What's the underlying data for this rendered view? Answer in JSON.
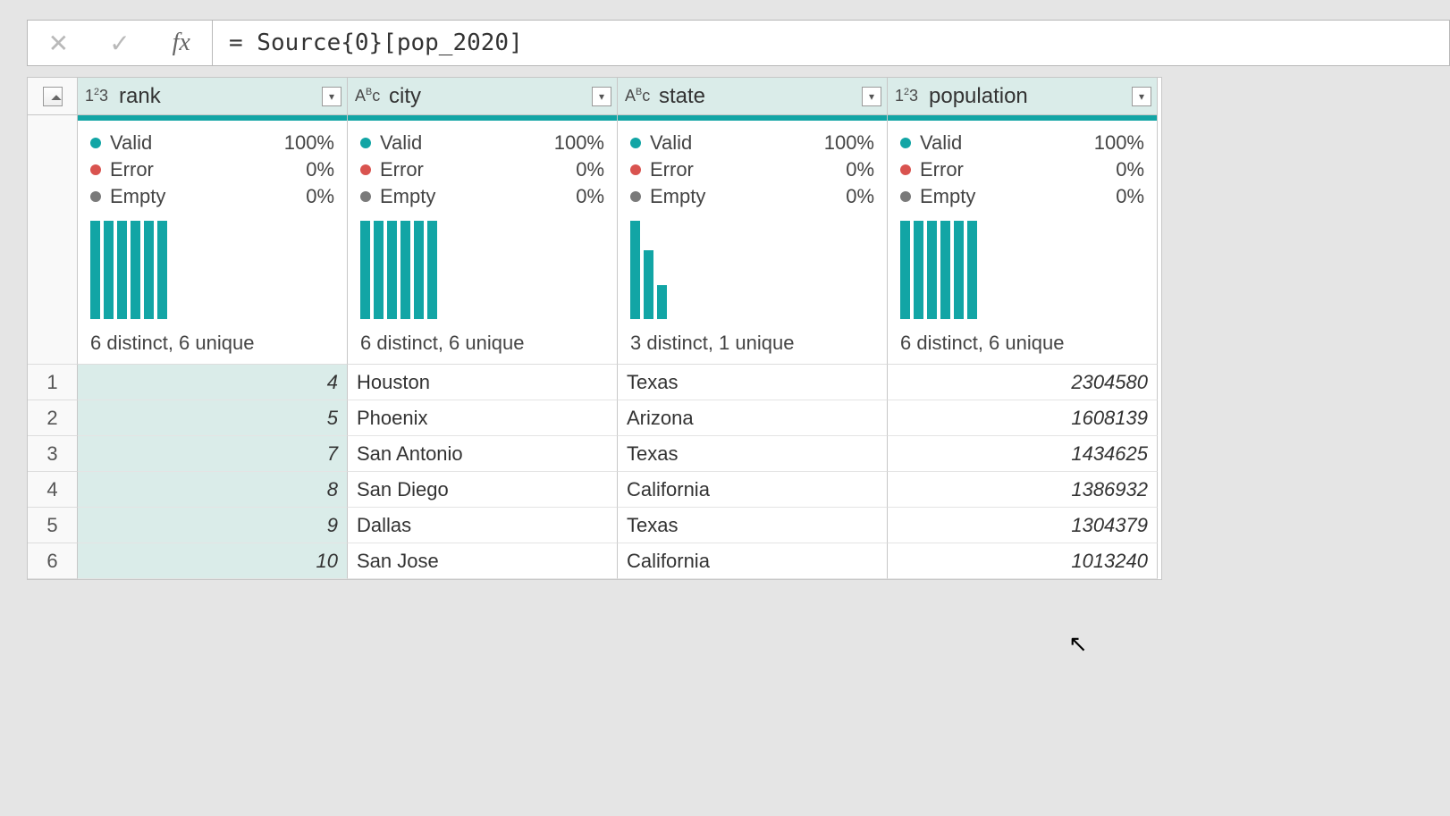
{
  "formula_bar": {
    "cancel_glyph": "✕",
    "confirm_glyph": "✓",
    "fx_label": "fx",
    "formula": "= Source{0}[pop_2020]"
  },
  "columns": [
    {
      "name": "rank",
      "type": "number",
      "quality": {
        "valid": "100%",
        "error": "0%",
        "empty": "0%"
      },
      "bars": [
        100,
        100,
        100,
        100,
        100,
        100
      ],
      "distinct": "6 distinct, 6 unique"
    },
    {
      "name": "city",
      "type": "text",
      "quality": {
        "valid": "100%",
        "error": "0%",
        "empty": "0%"
      },
      "bars": [
        100,
        100,
        100,
        100,
        100,
        100
      ],
      "distinct": "6 distinct, 6 unique"
    },
    {
      "name": "state",
      "type": "text",
      "quality": {
        "valid": "100%",
        "error": "0%",
        "empty": "0%"
      },
      "bars": [
        100,
        70,
        35
      ],
      "distinct": "3 distinct, 1 unique"
    },
    {
      "name": "population",
      "type": "number",
      "quality": {
        "valid": "100%",
        "error": "0%",
        "empty": "0%"
      },
      "bars": [
        100,
        100,
        100,
        100,
        100,
        100
      ],
      "distinct": "6 distinct, 6 unique"
    }
  ],
  "quality_labels": {
    "valid": "Valid",
    "error": "Error",
    "empty": "Empty"
  },
  "type_glyphs": {
    "number": "1²3",
    "text": "Aᴮc"
  },
  "rows": [
    {
      "n": "1",
      "rank": "4",
      "city": "Houston",
      "state": "Texas",
      "population": "2304580"
    },
    {
      "n": "2",
      "rank": "5",
      "city": "Phoenix",
      "state": "Arizona",
      "population": "1608139"
    },
    {
      "n": "3",
      "rank": "7",
      "city": "San Antonio",
      "state": "Texas",
      "population": "1434625"
    },
    {
      "n": "4",
      "rank": "8",
      "city": "San Diego",
      "state": "California",
      "population": "1386932"
    },
    {
      "n": "5",
      "rank": "9",
      "city": "Dallas",
      "state": "Texas",
      "population": "1304379"
    },
    {
      "n": "6",
      "rank": "10",
      "city": "San Jose",
      "state": "California",
      "population": "1013240"
    }
  ],
  "chart_data": [
    {
      "type": "bar",
      "title": "rank distribution",
      "categories": [
        "4",
        "5",
        "7",
        "8",
        "9",
        "10"
      ],
      "values": [
        1,
        1,
        1,
        1,
        1,
        1
      ]
    },
    {
      "type": "bar",
      "title": "city distribution",
      "categories": [
        "Houston",
        "Phoenix",
        "San Antonio",
        "San Diego",
        "Dallas",
        "San Jose"
      ],
      "values": [
        1,
        1,
        1,
        1,
        1,
        1
      ]
    },
    {
      "type": "bar",
      "title": "state distribution",
      "categories": [
        "Texas",
        "California",
        "Arizona"
      ],
      "values": [
        3,
        2,
        1
      ]
    },
    {
      "type": "bar",
      "title": "population distribution",
      "categories": [
        "2304580",
        "1608139",
        "1434625",
        "1386932",
        "1304379",
        "1013240"
      ],
      "values": [
        1,
        1,
        1,
        1,
        1,
        1
      ]
    }
  ]
}
